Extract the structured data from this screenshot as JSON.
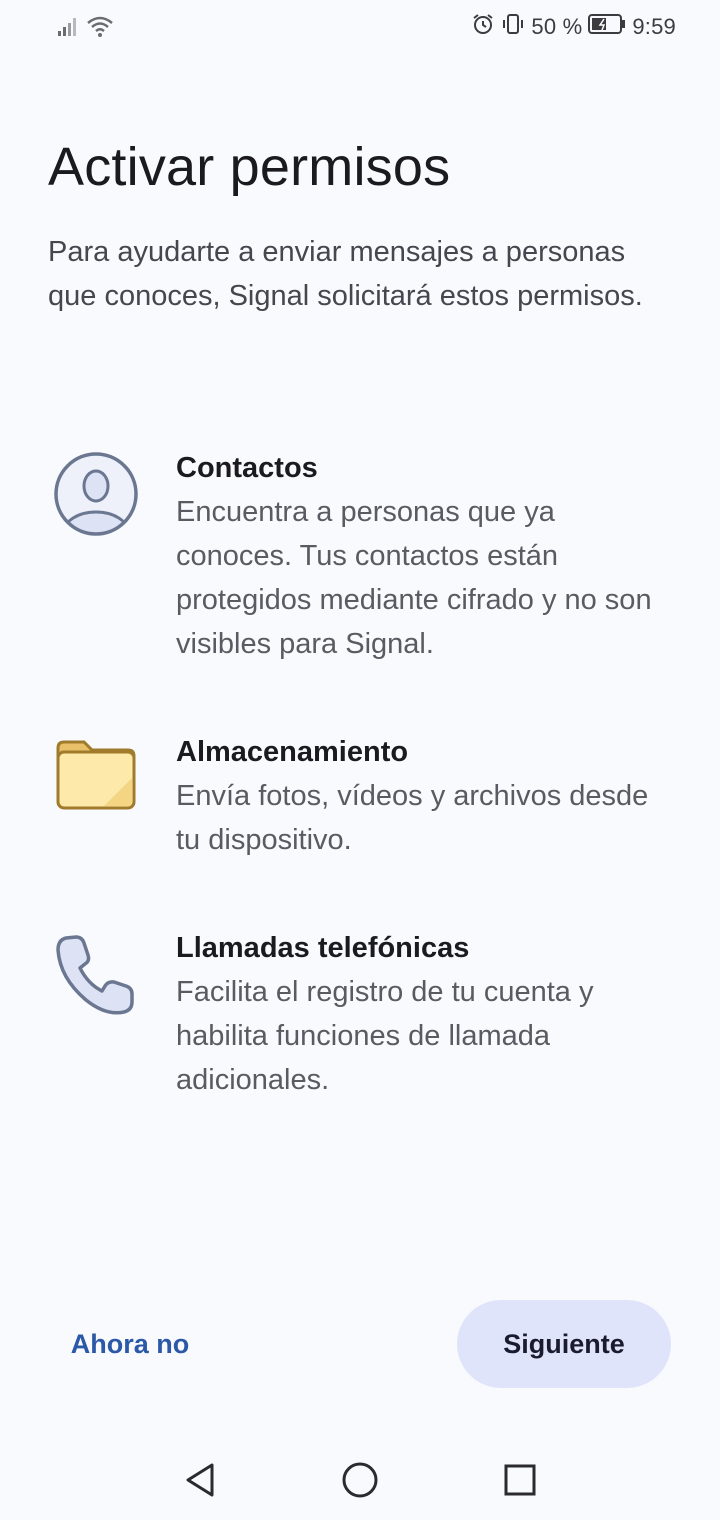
{
  "status_bar": {
    "battery_text": "50 %",
    "time": "9:59"
  },
  "title": "Activar permisos",
  "intro": "Para ayudarte a enviar mensajes a personas que conoces, Signal solicitará estos permisos.",
  "permissions": [
    {
      "icon": "contact-person-icon",
      "title": "Contactos",
      "description": "Encuentra a personas que ya conoces. Tus contactos están protegidos mediante cifrado y no son visibles para Signal."
    },
    {
      "icon": "folder-icon",
      "title": "Almacenamiento",
      "description": "Envía fotos, vídeos y archivos desde tu dispositivo."
    },
    {
      "icon": "phone-icon",
      "title": "Llamadas telefónicas",
      "description": "Facilita el registro de tu cuenta y habilita funciones de llamada adicionales."
    }
  ],
  "buttons": {
    "later": "Ahora no",
    "next": "Siguiente"
  },
  "colors": {
    "background": "#f9fafe",
    "accent": "#2c58a8",
    "next_button_bg": "#dfe4fb",
    "folder_fill": "#fde9a9",
    "folder_stroke": "#a07b2c",
    "icon_stroke": "#6b7790"
  }
}
